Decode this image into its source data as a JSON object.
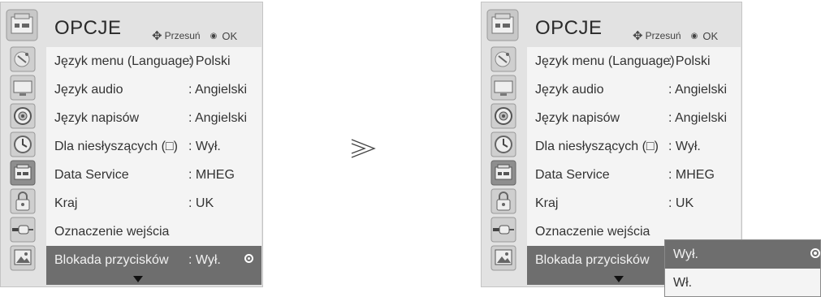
{
  "menu": {
    "title": "OPCJE",
    "nav_hint": "Przesuń",
    "ok_label": "OK",
    "move_glyph": "✥",
    "ok_glyph": "◉",
    "down_arrow": "▼",
    "items": [
      {
        "label": "Język menu (Language)",
        "value": ": Polski"
      },
      {
        "label": "Język  audio",
        "value": ": Angielski"
      },
      {
        "label": "Język  napisów",
        "value": ": Angielski"
      },
      {
        "label": "Dla niesłyszących (□)",
        "value": ": Wył."
      },
      {
        "label": "Data Service",
        "value": ": MHEG"
      },
      {
        "label": "Kraj",
        "value": ": UK"
      },
      {
        "label": "Oznaczenie wejścia",
        "value": ""
      },
      {
        "label": "Blokada przycisków",
        "value": ": Wył."
      }
    ],
    "sidebar_icons": [
      "antenna-icon",
      "monitor-icon",
      "speaker-icon",
      "clock-icon",
      "options-icon",
      "lock-icon",
      "input-icon",
      "photo-icon"
    ],
    "active_icon_index": 4
  },
  "transition": {
    "glyph": "⋙"
  },
  "popup": {
    "options": [
      "Wył.",
      "Wł."
    ],
    "selected_index": 0
  },
  "colors": {
    "panel": "#e2e2e2",
    "list": "#f4f4f4",
    "highlight": "#6e6e6e"
  }
}
